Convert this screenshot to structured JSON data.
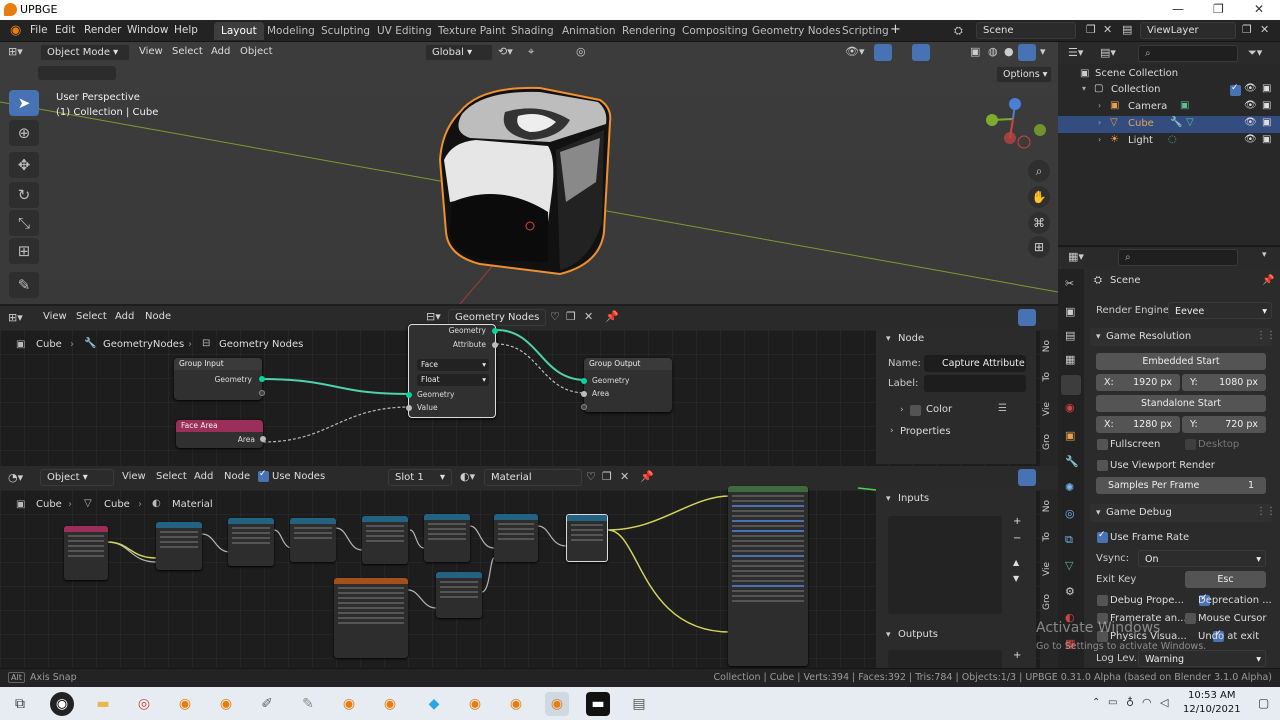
{
  "window": {
    "title": "UPBGE"
  },
  "menu": {
    "file": "File",
    "edit": "Edit",
    "render": "Render",
    "window": "Window",
    "help": "Help"
  },
  "workspaces": [
    "Layout",
    "Modeling",
    "Sculpting",
    "UV Editing",
    "Texture Paint",
    "Shading",
    "Animation",
    "Rendering",
    "Compositing",
    "Geometry Nodes",
    "Scripting"
  ],
  "active_workspace": "Layout",
  "scene_field": "Scene",
  "viewlayer_field": "ViewLayer",
  "viewport": {
    "mode": "Object Mode",
    "menus": [
      "View",
      "Select",
      "Add",
      "Object"
    ],
    "transform": "Global",
    "options": "Options",
    "perspective": "User Perspective",
    "collection_info": "(1) Collection | Cube"
  },
  "geonodes": {
    "menus": [
      "View",
      "Select",
      "Add",
      "Node"
    ],
    "tree_name": "Geometry Nodes",
    "breadcrumb": [
      "Cube",
      "GeometryNodes",
      "Geometry Nodes"
    ],
    "nodes": {
      "group_input": {
        "title": "Group Input",
        "out": "Geometry"
      },
      "face_area": {
        "title": "Face Area",
        "out": "Area"
      },
      "capture": {
        "out1": "Geometry",
        "out2": "Attribute",
        "domain": "Face",
        "type": "Float",
        "in1": "Geometry",
        "in2": "Value"
      },
      "group_output": {
        "title": "Group Output",
        "in1": "Geometry",
        "in2": "Area"
      }
    },
    "panel": {
      "title": "Node",
      "name_label": "Name:",
      "name_value": "Capture Attribute",
      "label_label": "Label:",
      "color": "Color",
      "properties": "Properties"
    },
    "tabs": [
      "No",
      "To",
      "Vie",
      "Gro"
    ]
  },
  "shader": {
    "type": "Object",
    "menus": [
      "View",
      "Select",
      "Add",
      "Node"
    ],
    "use_nodes": "Use Nodes",
    "slot": "Slot 1",
    "material": "Material",
    "breadcrumb": [
      "Cube",
      "Cube",
      "Material"
    ],
    "inputs": "Inputs",
    "outputs": "Outputs",
    "tabs": [
      "No",
      "To",
      "Vie",
      "Gro"
    ]
  },
  "outliner": {
    "title": "Scene Collection",
    "items": [
      {
        "label": "Collection",
        "icon": "collection-icon"
      },
      {
        "label": "Camera",
        "icon": "camera-icon"
      },
      {
        "label": "Cube",
        "icon": "mesh-icon"
      },
      {
        "label": "Light",
        "icon": "light-icon"
      }
    ]
  },
  "properties": {
    "scene": "Scene",
    "render_engine_label": "Render Engine",
    "render_engine": "Eevee",
    "game_resolution": "Game Resolution",
    "embedded_start": "Embedded Start",
    "emb_x_label": "X:",
    "emb_x": "1920 px",
    "emb_y_label": "Y:",
    "emb_y": "1080 px",
    "standalone_start": "Standalone Start",
    "sa_x_label": "X:",
    "sa_x": "1280 px",
    "sa_y_label": "Y:",
    "sa_y": "720 px",
    "fullscreen": "Fullscreen",
    "desktop": "Desktop",
    "use_viewport_render": "Use Viewport Render",
    "samples_label": "Samples Per Frame",
    "samples": "1",
    "game_debug": "Game Debug",
    "use_frame_rate": "Use Frame Rate",
    "vsync_label": "Vsync:",
    "vsync": "On",
    "exit_key_label": "Exit Key",
    "exit_key": "Esc",
    "debug_props": "Debug Prope...",
    "deprecation": "Deprecation ...",
    "framerate": "Framerate an...",
    "mouse_cursor": "Mouse Cursor",
    "physics": "Physics Visua...",
    "undo_exit": "Undo at exit",
    "log_level_label": "Log Lev...",
    "log_level": "Warning"
  },
  "watermark": {
    "line1": "Activate Windows",
    "line2": "Go to Settings to activate Windows."
  },
  "status": {
    "left": "Axis Snap",
    "right": "Collection | Cube | Verts:394 | Faces:392 | Tris:784 | Objects:1/3 | UPBGE 0.31.0 Alpha (based on Blender 3.1.0 Alpha)"
  },
  "clock": {
    "time": "10:53 AM",
    "date": "12/10/2021"
  },
  "colors": {
    "accent": "#4772b3",
    "selection": "#334d80",
    "orange": "#e87d0d",
    "geometry_link": "#00d6a3"
  }
}
